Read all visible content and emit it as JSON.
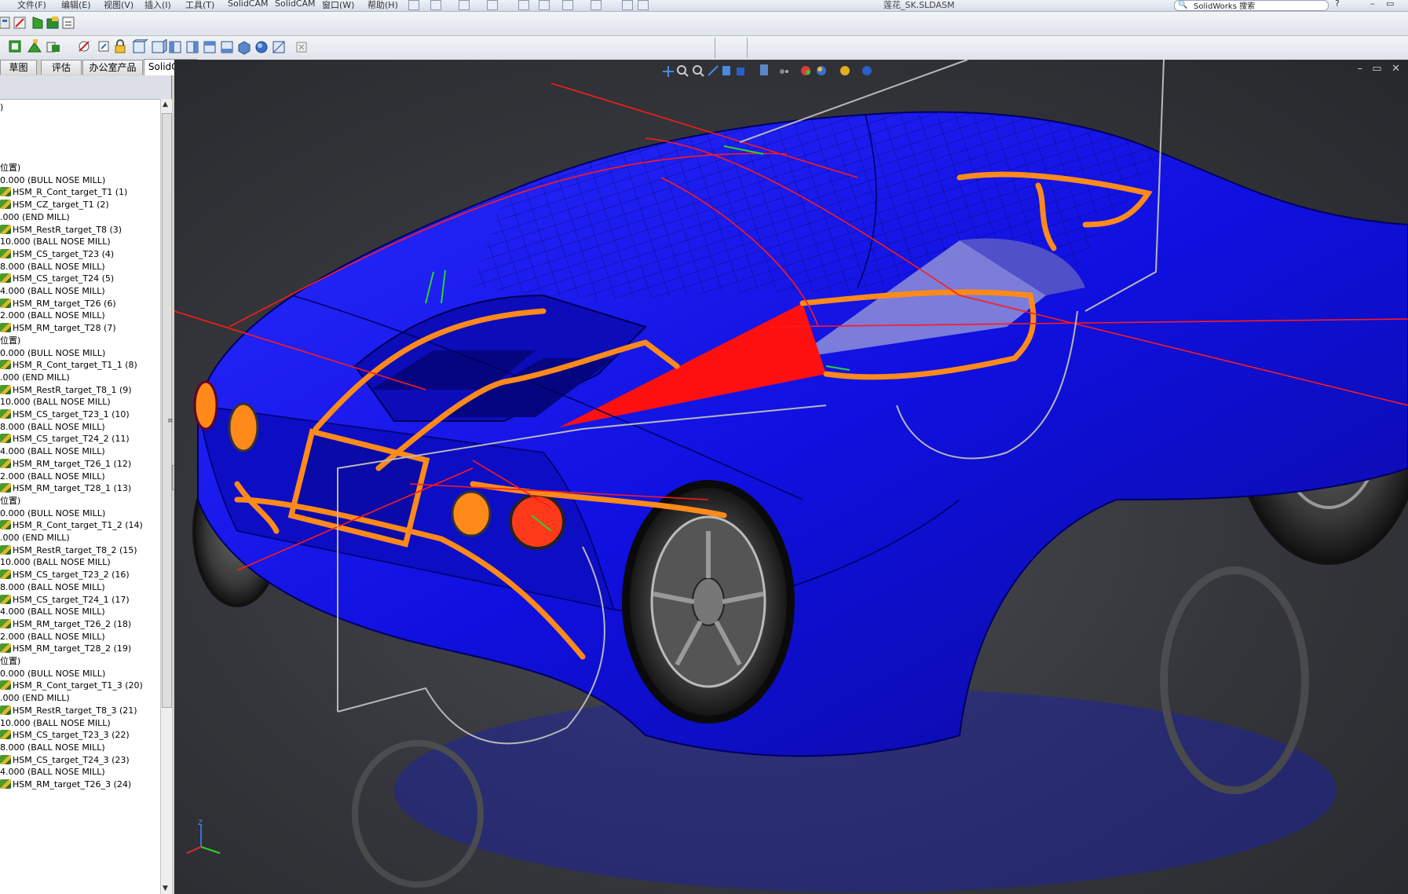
{
  "menu": {
    "items": [
      "文件(F)",
      "编辑(E)",
      "视图(V)",
      "插入(I)",
      "工具(T)",
      "SolidCAM",
      "SolidCAM",
      "窗口(W)",
      "帮助(H)"
    ],
    "document_title": "莲花_SK.SLDASM",
    "search_label": "SolidWorks 搜索"
  },
  "tabs": [
    "草图",
    "评估",
    "办公室产品",
    "SolidCAM"
  ],
  "tree": {
    "root_label": ")",
    "rows": [
      {
        "type": "group",
        "text": "位置)"
      },
      {
        "type": "tool",
        "text": "0.000 (BULL NOSE MILL)"
      },
      {
        "type": "op",
        "text": "HSM_R_Cont_target_T1 (1)"
      },
      {
        "type": "op",
        "text": "HSM_CZ_target_T1 (2)"
      },
      {
        "type": "tool",
        "text": ".000 (END MILL)"
      },
      {
        "type": "op",
        "text": "HSM_RestR_target_T8 (3)"
      },
      {
        "type": "tool",
        "text": "10.000 (BALL NOSE MILL)"
      },
      {
        "type": "op",
        "text": "HSM_CS_target_T23 (4)"
      },
      {
        "type": "tool",
        "text": "8.000 (BALL NOSE MILL)"
      },
      {
        "type": "op",
        "text": "HSM_CS_target_T24 (5)"
      },
      {
        "type": "tool",
        "text": "4.000 (BALL NOSE MILL)"
      },
      {
        "type": "op",
        "text": "HSM_RM_target_T26 (6)"
      },
      {
        "type": "tool",
        "text": "2.000 (BALL NOSE MILL)"
      },
      {
        "type": "op",
        "text": "HSM_RM_target_T28 (7)"
      },
      {
        "type": "group",
        "text": "位置)"
      },
      {
        "type": "tool",
        "text": "0.000 (BULL NOSE MILL)"
      },
      {
        "type": "op",
        "text": "HSM_R_Cont_target_T1_1 (8)"
      },
      {
        "type": "tool",
        "text": ".000 (END MILL)"
      },
      {
        "type": "op",
        "text": "HSM_RestR_target_T8_1 (9)"
      },
      {
        "type": "tool",
        "text": "10.000 (BALL NOSE MILL)"
      },
      {
        "type": "op",
        "text": "HSM_CS_target_T23_1 (10)"
      },
      {
        "type": "tool",
        "text": "8.000 (BALL NOSE MILL)"
      },
      {
        "type": "op",
        "text": "HSM_CS_target_T24_2 (11)"
      },
      {
        "type": "tool",
        "text": "4.000 (BALL NOSE MILL)"
      },
      {
        "type": "op",
        "text": "HSM_RM_target_T26_1 (12)"
      },
      {
        "type": "tool",
        "text": "2.000 (BALL NOSE MILL)"
      },
      {
        "type": "op",
        "text": "HSM_RM_target_T28_1 (13)"
      },
      {
        "type": "group",
        "text": "位置)"
      },
      {
        "type": "tool",
        "text": "0.000 (BULL NOSE MILL)"
      },
      {
        "type": "op",
        "text": "HSM_R_Cont_target_T1_2 (14)"
      },
      {
        "type": "tool",
        "text": ".000 (END MILL)"
      },
      {
        "type": "op",
        "text": "HSM_RestR_target_T8_2 (15)"
      },
      {
        "type": "tool",
        "text": "10.000 (BALL NOSE MILL)"
      },
      {
        "type": "op",
        "text": "HSM_CS_target_T23_2 (16)"
      },
      {
        "type": "tool",
        "text": "8.000 (BALL NOSE MILL)"
      },
      {
        "type": "op",
        "text": "HSM_CS_target_T24_1 (17)"
      },
      {
        "type": "tool",
        "text": "4.000 (BALL NOSE MILL)"
      },
      {
        "type": "op",
        "text": "HSM_RM_target_T26_2 (18)"
      },
      {
        "type": "tool",
        "text": "2.000 (BALL NOSE MILL)"
      },
      {
        "type": "op",
        "text": "HSM_RM_target_T28_2 (19)"
      },
      {
        "type": "group",
        "text": "位置)"
      },
      {
        "type": "tool",
        "text": "0.000 (BULL NOSE MILL)"
      },
      {
        "type": "op",
        "text": "HSM_R_Cont_target_T1_3 (20)"
      },
      {
        "type": "tool",
        "text": ".000 (END MILL)"
      },
      {
        "type": "op",
        "text": "HSM_RestR_target_T8_3 (21)"
      },
      {
        "type": "tool",
        "text": "10.000 (BALL NOSE MILL)"
      },
      {
        "type": "op",
        "text": "HSM_CS_target_T23_3 (22)"
      },
      {
        "type": "tool",
        "text": "8.000 (BALL NOSE MILL)"
      },
      {
        "type": "op",
        "text": "HSM_CS_target_T24_3 (23)"
      },
      {
        "type": "tool",
        "text": "4.000 (BALL NOSE MILL)"
      },
      {
        "type": "op",
        "text": "HSM_RM_target_T26_3 (24)"
      }
    ]
  },
  "colors": {
    "model_body": "#1010e0",
    "toolpath": "#ff8a1a",
    "cut_region": "#ff1010",
    "viewport_bg": "#34363b"
  },
  "view_toolbar_icons": [
    "view-orient-icon",
    "zoom-fit-icon",
    "zoom-area-icon",
    "rotate-icon",
    "section-view-icon",
    "display-style-icon",
    "standard-views-icon",
    "hide-show-icon",
    "appearance-icon",
    "scene-icon",
    "realview-icon",
    "render-icon"
  ],
  "triad": {
    "axis_label": "Z"
  }
}
